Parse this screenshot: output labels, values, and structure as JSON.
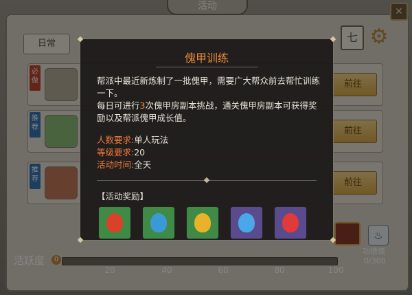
{
  "window": {
    "title": "活动"
  },
  "tabs": {
    "daily": "日常"
  },
  "rows": [
    {
      "badge": "必做",
      "badge_color": "#c2462e",
      "button": "前往"
    },
    {
      "badge": "推荐",
      "badge_color": "#3a78b8",
      "button": "前往"
    },
    {
      "badge": "推荐",
      "badge_color": "#3a78b8",
      "button": "前往"
    }
  ],
  "activity": {
    "label": "活跃度",
    "score": "0",
    "progress": 0,
    "ticks": [
      "20",
      "40",
      "60",
      "80",
      "100"
    ]
  },
  "merit": {
    "label": "功德值",
    "value": "0/300"
  },
  "popup": {
    "title": "傀甲训练",
    "desc1": "帮派中最近新炼制了一批傀甲，需要广大帮众前去帮忙训练一下。",
    "desc2_pre": "每日可进行",
    "desc2_num": "3",
    "desc2_post": "次傀甲房副本挑战，通关傀甲房副本可获得奖励以及帮派傀甲成长值。",
    "requirements": [
      {
        "key": "人数要求:",
        "value": "单人玩法"
      },
      {
        "key": "等级要求:",
        "value": "20"
      },
      {
        "key": "活动时间:",
        "value": "全天"
      }
    ],
    "reward_title": "【活动奖励】",
    "rewards": [
      {
        "icon": "red-rune-icon",
        "frame": "#3f8a45",
        "color": "#d9412a"
      },
      {
        "icon": "blue-rune-icon",
        "frame": "#3f8a45",
        "color": "#3a9ad8"
      },
      {
        "icon": "gold-rune-icon",
        "frame": "#3f8a45",
        "color": "#e8b22a"
      },
      {
        "icon": "blue-crystal-icon",
        "frame": "#5a4a8e",
        "color": "#4aa8e8"
      },
      {
        "icon": "red-crystal-icon",
        "frame": "#5a4a8e",
        "color": "#e03a3a"
      }
    ],
    "accent_color": "#f08c3a"
  }
}
